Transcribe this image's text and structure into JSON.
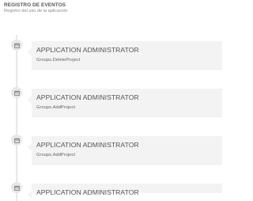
{
  "header": {
    "title": "REGISTRO DE EVENTOS",
    "subtitle": "Registro del uso de la aplicación"
  },
  "events": [
    {
      "actor": "APPLICATION ADMINISTRATOR",
      "detail": "Groups.DeleteProject",
      "icon": "calendar-icon"
    },
    {
      "actor": "APPLICATION ADMINISTRATOR",
      "detail": "Groups.AddProject",
      "icon": "calendar-icon"
    },
    {
      "actor": "APPLICATION ADMINISTRATOR",
      "detail": "Groups.AddProject",
      "icon": "calendar-icon"
    },
    {
      "actor": "APPLICATION ADMINISTRATOR",
      "detail": "",
      "icon": "calendar-icon"
    }
  ],
  "colors": {
    "card_background": "#f3f3f3",
    "marker_background": "#e7e7e7",
    "timeline_line": "#e8e8e8",
    "text": "#555555"
  }
}
